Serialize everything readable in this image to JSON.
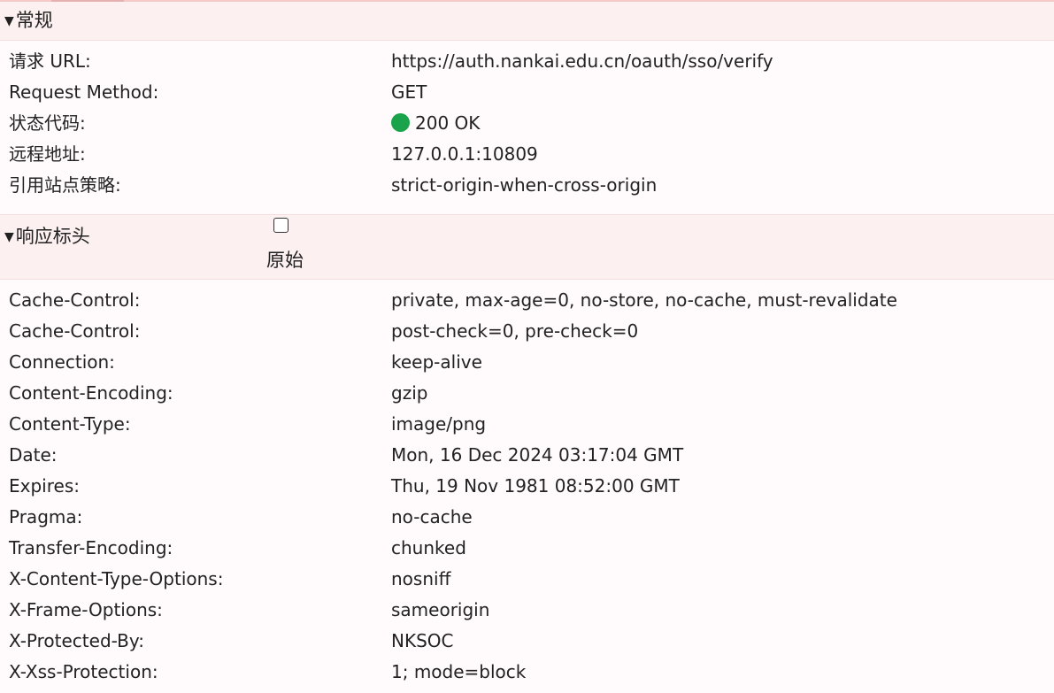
{
  "general": {
    "title": "常规",
    "toggle_glyph": "▼",
    "rows": [
      {
        "key": "请求 URL:",
        "value": "https://auth.nankai.edu.cn/oauth/sso/verify"
      },
      {
        "key": "Request Method:",
        "value": "GET"
      },
      {
        "key": "状态代码:",
        "value": "200 OK",
        "status_color": "#1aa34a"
      },
      {
        "key": "远程地址:",
        "value": "127.0.0.1:10809"
      },
      {
        "key": "引用站点策略:",
        "value": "strict-origin-when-cross-origin"
      }
    ]
  },
  "response_headers": {
    "title": "响应标头",
    "toggle_glyph": "▼",
    "raw_label": "原始",
    "raw_checked": false,
    "rows": [
      {
        "key": "Cache-Control:",
        "value": "private, max-age=0, no-store, no-cache, must-revalidate"
      },
      {
        "key": "Cache-Control:",
        "value": "post-check=0, pre-check=0"
      },
      {
        "key": "Connection:",
        "value": "keep-alive"
      },
      {
        "key": "Content-Encoding:",
        "value": "gzip"
      },
      {
        "key": "Content-Type:",
        "value": "image/png"
      },
      {
        "key": "Date:",
        "value": "Mon, 16 Dec 2024 03:17:04 GMT"
      },
      {
        "key": "Expires:",
        "value": "Thu, 19 Nov 1981 08:52:00 GMT"
      },
      {
        "key": "Pragma:",
        "value": "no-cache"
      },
      {
        "key": "Transfer-Encoding:",
        "value": "chunked"
      },
      {
        "key": "X-Content-Type-Options:",
        "value": "nosniff"
      },
      {
        "key": "X-Frame-Options:",
        "value": "sameorigin"
      },
      {
        "key": "X-Protected-By:",
        "value": "NKSOC"
      },
      {
        "key": "X-Xss-Protection:",
        "value": "1; mode=block"
      }
    ]
  },
  "colors": {
    "header_bg": "#fdf0f0",
    "page_bg": "#fffafb",
    "status_ok": "#1aa34a"
  }
}
